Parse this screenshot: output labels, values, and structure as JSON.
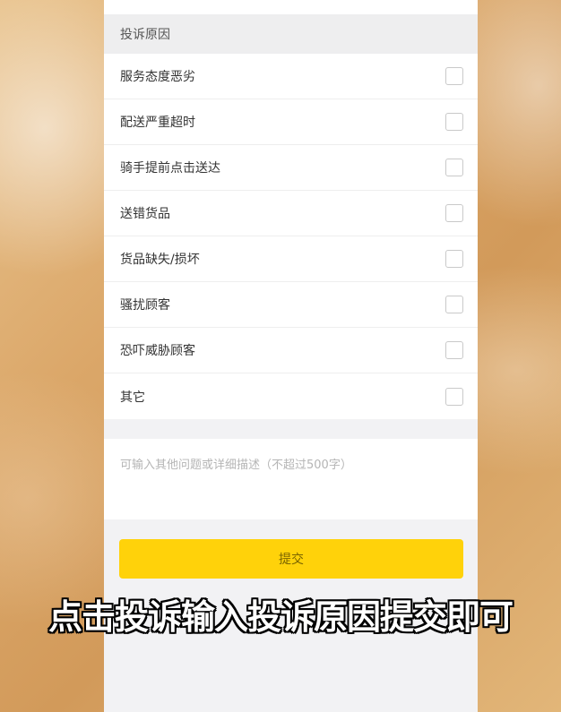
{
  "complaint_form": {
    "section_title": "投诉原因",
    "reasons": [
      {
        "label": "服务态度恶劣",
        "checked": false
      },
      {
        "label": "配送严重超时",
        "checked": false
      },
      {
        "label": "骑手提前点击送达",
        "checked": false
      },
      {
        "label": "送错货品",
        "checked": false
      },
      {
        "label": "货品缺失/损坏",
        "checked": false
      },
      {
        "label": "骚扰顾客",
        "checked": false
      },
      {
        "label": "恐吓威胁顾客",
        "checked": false
      },
      {
        "label": "其它",
        "checked": false
      }
    ],
    "description_placeholder": "可输入其他问题或详细描述（不超过500字）",
    "description_value": "",
    "submit_label": "提交"
  },
  "caption": "点击投诉输入投诉原因提交即可",
  "colors": {
    "submit_button": "#ffd20a",
    "caption_text": "#ffffff",
    "caption_outline": "#000000"
  }
}
